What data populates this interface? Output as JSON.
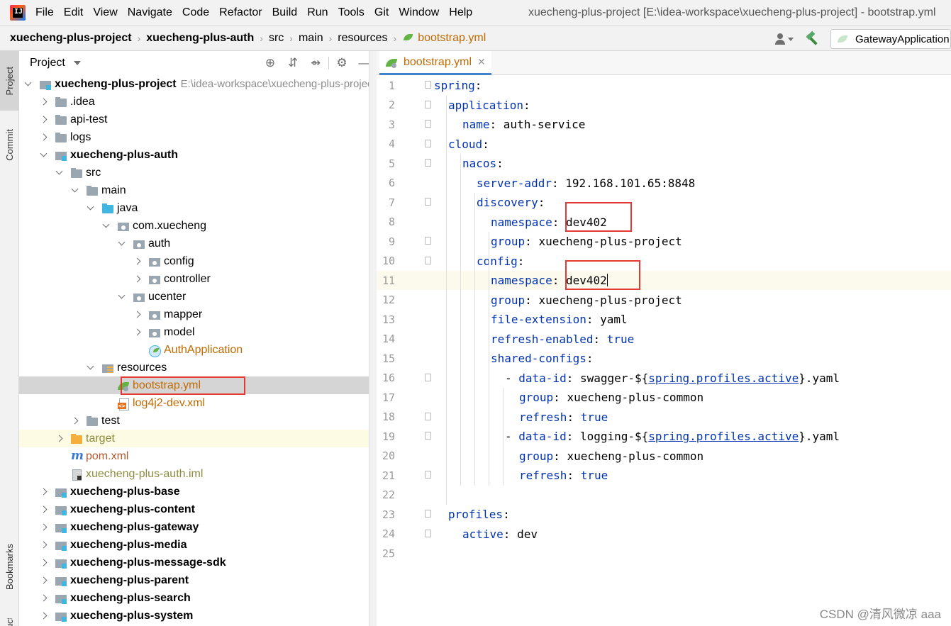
{
  "menubar": {
    "items": [
      "File",
      "Edit",
      "View",
      "Navigate",
      "Code",
      "Refactor",
      "Build",
      "Run",
      "Tools",
      "Git",
      "Window",
      "Help"
    ],
    "window_title": "xuecheng-plus-project [E:\\idea-workspace\\xuecheng-plus-project] - bootstrap.yml"
  },
  "breadcrumb": {
    "items": [
      "xuecheng-plus-project",
      "xuecheng-plus-auth",
      "src",
      "main",
      "resources",
      "bootstrap.yml"
    ]
  },
  "run_config": {
    "label": "GatewayApplication"
  },
  "left_stripe": {
    "project": "Project",
    "commit": "Commit",
    "bookmarks": "Bookmarks",
    "structure": "Structure"
  },
  "project_panel": {
    "title": "Project",
    "root_path": "E:\\idea-workspace\\xuecheng-plus-project",
    "tree": [
      {
        "label": "xuecheng-plus-project",
        "depth": 0,
        "arrow": "down",
        "icon": "module",
        "style": "bold"
      },
      {
        "label": ".idea",
        "depth": 1,
        "arrow": "right",
        "icon": "folder",
        "style": "normal"
      },
      {
        "label": "api-test",
        "depth": 1,
        "arrow": "right",
        "icon": "folder",
        "style": "normal"
      },
      {
        "label": "logs",
        "depth": 1,
        "arrow": "right",
        "icon": "folder",
        "style": "normal"
      },
      {
        "label": "xuecheng-plus-auth",
        "depth": 1,
        "arrow": "down",
        "icon": "module",
        "style": "bold"
      },
      {
        "label": "src",
        "depth": 2,
        "arrow": "down",
        "icon": "folder",
        "style": "normal"
      },
      {
        "label": "main",
        "depth": 3,
        "arrow": "down",
        "icon": "folder",
        "style": "normal"
      },
      {
        "label": "java",
        "depth": 4,
        "arrow": "down",
        "icon": "folder-blue",
        "style": "normal"
      },
      {
        "label": "com.xuecheng",
        "depth": 5,
        "arrow": "down",
        "icon": "package",
        "style": "normal"
      },
      {
        "label": "auth",
        "depth": 6,
        "arrow": "down",
        "icon": "package",
        "style": "normal"
      },
      {
        "label": "config",
        "depth": 7,
        "arrow": "right",
        "icon": "package",
        "style": "normal"
      },
      {
        "label": "controller",
        "depth": 7,
        "arrow": "right",
        "icon": "package",
        "style": "normal"
      },
      {
        "label": "ucenter",
        "depth": 6,
        "arrow": "down",
        "icon": "package",
        "style": "normal"
      },
      {
        "label": "mapper",
        "depth": 7,
        "arrow": "right",
        "icon": "package",
        "style": "normal"
      },
      {
        "label": "model",
        "depth": 7,
        "arrow": "right",
        "icon": "package",
        "style": "normal"
      },
      {
        "label": "AuthApplication",
        "depth": 7,
        "arrow": "none",
        "icon": "spring-class",
        "style": "orange"
      },
      {
        "label": "resources",
        "depth": 4,
        "arrow": "down",
        "icon": "resources-folder",
        "style": "normal"
      },
      {
        "label": "bootstrap.yml",
        "depth": 5,
        "arrow": "none",
        "icon": "yml-file",
        "style": "orange",
        "selected": true
      },
      {
        "label": "log4j2-dev.xml",
        "depth": 5,
        "arrow": "none",
        "icon": "xml-file",
        "style": "orange"
      },
      {
        "label": "test",
        "depth": 3,
        "arrow": "right",
        "icon": "folder",
        "style": "normal"
      },
      {
        "label": "target",
        "depth": 2,
        "arrow": "right",
        "icon": "folder-orange",
        "style": "olive",
        "target": true
      },
      {
        "label": "pom.xml",
        "depth": 2,
        "arrow": "none",
        "icon": "maven-file",
        "style": "red"
      },
      {
        "label": "xuecheng-plus-auth.iml",
        "depth": 2,
        "arrow": "none",
        "icon": "iml-file",
        "style": "olive"
      },
      {
        "label": "xuecheng-plus-base",
        "depth": 1,
        "arrow": "right",
        "icon": "module",
        "style": "bold"
      },
      {
        "label": "xuecheng-plus-content",
        "depth": 1,
        "arrow": "right",
        "icon": "module",
        "style": "bold"
      },
      {
        "label": "xuecheng-plus-gateway",
        "depth": 1,
        "arrow": "right",
        "icon": "module",
        "style": "bold"
      },
      {
        "label": "xuecheng-plus-media",
        "depth": 1,
        "arrow": "right",
        "icon": "module",
        "style": "bold"
      },
      {
        "label": "xuecheng-plus-message-sdk",
        "depth": 1,
        "arrow": "right",
        "icon": "module",
        "style": "bold"
      },
      {
        "label": "xuecheng-plus-parent",
        "depth": 1,
        "arrow": "right",
        "icon": "module",
        "style": "bold"
      },
      {
        "label": "xuecheng-plus-search",
        "depth": 1,
        "arrow": "right",
        "icon": "module",
        "style": "bold"
      },
      {
        "label": "xuecheng-plus-system",
        "depth": 1,
        "arrow": "right",
        "icon": "module",
        "style": "bold"
      }
    ]
  },
  "editor": {
    "tab_label": "bootstrap.yml",
    "current_line": 11,
    "lines": [
      {
        "n": "1",
        "indent": 0,
        "fold": true,
        "parts": [
          [
            "key",
            "spring"
          ],
          [
            "plain",
            ":"
          ]
        ]
      },
      {
        "n": "2",
        "indent": 1,
        "fold": true,
        "parts": [
          [
            "key",
            "application"
          ],
          [
            "plain",
            ":"
          ]
        ]
      },
      {
        "n": "3",
        "indent": 2,
        "fold": true,
        "parts": [
          [
            "key",
            "name"
          ],
          [
            "plain",
            ": auth-service"
          ]
        ]
      },
      {
        "n": "4",
        "indent": 1,
        "fold": true,
        "parts": [
          [
            "key",
            "cloud"
          ],
          [
            "plain",
            ":"
          ]
        ]
      },
      {
        "n": "5",
        "indent": 2,
        "fold": true,
        "parts": [
          [
            "key",
            "nacos"
          ],
          [
            "plain",
            ":"
          ]
        ]
      },
      {
        "n": "6",
        "indent": 3,
        "fold": false,
        "parts": [
          [
            "key",
            "server-addr"
          ],
          [
            "plain",
            ": 192.168.101.65:8848"
          ]
        ]
      },
      {
        "n": "7",
        "indent": 3,
        "fold": true,
        "parts": [
          [
            "key",
            "discovery"
          ],
          [
            "plain",
            ":"
          ]
        ]
      },
      {
        "n": "8",
        "indent": 4,
        "fold": false,
        "parts": [
          [
            "key",
            "namespace"
          ],
          [
            "plain",
            ": dev402"
          ]
        ]
      },
      {
        "n": "9",
        "indent": 4,
        "fold": true,
        "parts": [
          [
            "key",
            "group"
          ],
          [
            "plain",
            ": xuecheng-plus-project"
          ]
        ]
      },
      {
        "n": "10",
        "indent": 3,
        "fold": true,
        "parts": [
          [
            "key",
            "config"
          ],
          [
            "plain",
            ":"
          ]
        ]
      },
      {
        "n": "11",
        "indent": 4,
        "fold": false,
        "parts": [
          [
            "key",
            "namespace"
          ],
          [
            "plain",
            ": dev402"
          ]
        ]
      },
      {
        "n": "12",
        "indent": 4,
        "fold": false,
        "parts": [
          [
            "key",
            "group"
          ],
          [
            "plain",
            ": xuecheng-plus-project"
          ]
        ]
      },
      {
        "n": "13",
        "indent": 4,
        "fold": false,
        "parts": [
          [
            "key",
            "file-extension"
          ],
          [
            "plain",
            ": yaml"
          ]
        ]
      },
      {
        "n": "14",
        "indent": 4,
        "fold": false,
        "parts": [
          [
            "key",
            "refresh-enabled"
          ],
          [
            "plain",
            ": "
          ],
          [
            "key",
            "true"
          ]
        ]
      },
      {
        "n": "15",
        "indent": 4,
        "fold": false,
        "parts": [
          [
            "key",
            "shared-configs"
          ],
          [
            "plain",
            ":"
          ]
        ]
      },
      {
        "n": "16",
        "indent": 5,
        "fold": true,
        "parts": [
          [
            "plain",
            "- "
          ],
          [
            "key",
            "data-id"
          ],
          [
            "plain",
            ": swagger-${"
          ],
          [
            "link",
            "spring.profiles.active"
          ],
          [
            "plain",
            "}.yaml"
          ]
        ]
      },
      {
        "n": "17",
        "indent": 6,
        "fold": false,
        "parts": [
          [
            "key",
            "group"
          ],
          [
            "plain",
            ": xuecheng-plus-common"
          ]
        ]
      },
      {
        "n": "18",
        "indent": 6,
        "fold": true,
        "parts": [
          [
            "key",
            "refresh"
          ],
          [
            "plain",
            ": "
          ],
          [
            "key",
            "true"
          ]
        ]
      },
      {
        "n": "19",
        "indent": 5,
        "fold": true,
        "parts": [
          [
            "plain",
            "- "
          ],
          [
            "key",
            "data-id"
          ],
          [
            "plain",
            ": logging-${"
          ],
          [
            "link",
            "spring.profiles.active"
          ],
          [
            "plain",
            "}.yaml"
          ]
        ]
      },
      {
        "n": "20",
        "indent": 6,
        "fold": false,
        "parts": [
          [
            "key",
            "group"
          ],
          [
            "plain",
            ": xuecheng-plus-common"
          ]
        ]
      },
      {
        "n": "21",
        "indent": 6,
        "fold": true,
        "parts": [
          [
            "key",
            "refresh"
          ],
          [
            "plain",
            ": "
          ],
          [
            "key",
            "true"
          ]
        ]
      },
      {
        "n": "22",
        "indent": 0,
        "fold": false,
        "parts": []
      },
      {
        "n": "23",
        "indent": 1,
        "fold": true,
        "parts": [
          [
            "key",
            "profiles"
          ],
          [
            "plain",
            ":"
          ]
        ]
      },
      {
        "n": "24",
        "indent": 2,
        "fold": true,
        "parts": [
          [
            "key",
            "active"
          ],
          [
            "plain",
            ": dev"
          ]
        ]
      },
      {
        "n": "25",
        "indent": 0,
        "fold": false,
        "parts": []
      }
    ]
  },
  "watermark": "CSDN @清风微凉 aaa",
  "colors": {
    "key": "#0033b3",
    "selection": "#d5d5d5",
    "highlight_box": "#e53935",
    "orange_label": "#c26a00"
  }
}
